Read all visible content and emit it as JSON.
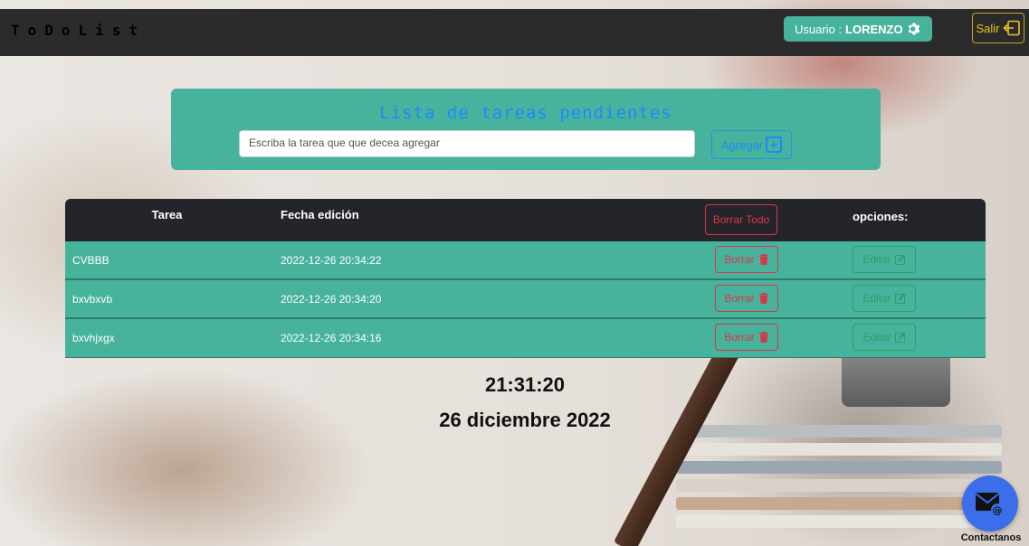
{
  "navbar": {
    "brand": "ToDoList",
    "user_prefix": "Usuario : ",
    "user_name": "LORENZO",
    "logout_label": "Salir"
  },
  "form": {
    "title": "Lista de tareas pendientes",
    "input_placeholder": "Escriba la tarea que que decea agregar",
    "input_value": "",
    "add_label": "Agregar"
  },
  "table": {
    "headers": {
      "task": "Tarea",
      "date": "Fecha edición",
      "delete_all": "Borrar Todo",
      "options": "opciones:"
    },
    "rows": [
      {
        "task": "CVBBB",
        "date": "2022-12-26 20:34:22",
        "delete": "Borrar",
        "edit": "Editar"
      },
      {
        "task": "bxvbxvb",
        "date": "2022-12-26 20:34:20",
        "delete": "Borrar",
        "edit": "Editar"
      },
      {
        "task": "bxvhjxgx",
        "date": "2022-12-26 20:34:16",
        "delete": "Borrar",
        "edit": "Editar"
      }
    ]
  },
  "clock": {
    "time": "21:31:20",
    "date": "26 diciembre 2022"
  },
  "contact": {
    "label": "Contactanos"
  },
  "icons": {
    "gear": "gear-icon",
    "logout": "logout-icon",
    "plus": "plus-square-icon",
    "trash": "trash-icon",
    "edit": "edit-icon",
    "mail": "mail-at-icon"
  },
  "colors": {
    "navbar": "#2b2b2b",
    "accent": "#47b39c",
    "primary": "#1e88ff",
    "danger": "#dc3545",
    "success": "#2e9e67",
    "warning": "#f0c020",
    "fab": "#3b6ee8"
  }
}
